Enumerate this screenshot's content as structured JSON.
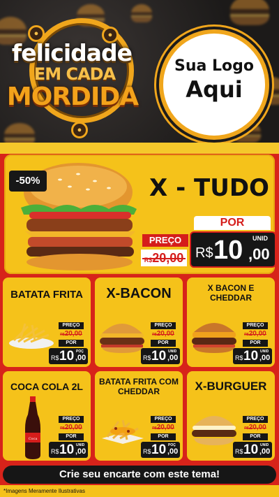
{
  "header": {
    "brand_line1": "felicidade",
    "brand_line2": "EM CADA",
    "brand_line3": "MORDIDA",
    "logo_line1": "Sua Logo",
    "logo_line2": "Aqui"
  },
  "hero": {
    "discount": "-50%",
    "title": "X - TUDO",
    "preco_label": "PREÇO",
    "old_currency": "R$",
    "old_price": "20,00",
    "por_label": "POR",
    "currency": "R$",
    "price_int": "10",
    "price_cents": ",00",
    "unit": "UNID"
  },
  "cards": [
    {
      "name": "BATATA FRITA",
      "preco_label": "PREÇO",
      "old_currency": "R$",
      "old_price": "20,00",
      "por_label": "POR",
      "currency": "R$",
      "price_int": "10",
      "price_cents": ",00",
      "unit": "POÇ"
    },
    {
      "name": "X-BACON",
      "preco_label": "PREÇO",
      "old_currency": "R$",
      "old_price": "20,00",
      "por_label": "POR",
      "currency": "R$",
      "price_int": "10",
      "price_cents": ",00",
      "unit": "UNID"
    },
    {
      "name": "X BACON E CHEDDAR",
      "preco_label": "PREÇO",
      "old_currency": "R$",
      "old_price": "20,00",
      "por_label": "POR",
      "currency": "R$",
      "price_int": "10",
      "price_cents": ",00",
      "unit": "UNID"
    },
    {
      "name": "COCA COLA 2L",
      "preco_label": "PREÇO",
      "old_currency": "R$",
      "old_price": "20,00",
      "por_label": "POR",
      "currency": "R$",
      "price_int": "10",
      "price_cents": ",00",
      "unit": "UNID"
    },
    {
      "name": "BATATA FRITA COM CHEDDAR",
      "preco_label": "PREÇO",
      "old_currency": "R$",
      "old_price": "20,00",
      "por_label": "POR",
      "currency": "R$",
      "price_int": "10",
      "price_cents": ",00",
      "unit": "POÇ"
    },
    {
      "name": "X-BURGUER",
      "preco_label": "PREÇO",
      "old_currency": "R$",
      "old_price": "20,00",
      "por_label": "POR",
      "currency": "R$",
      "price_int": "10",
      "price_cents": ",00",
      "unit": "UNID"
    }
  ],
  "cta": "Crie seu encarte com este tema!",
  "disclaimer": "*Imagens Meramente Ilustrativas",
  "colors": {
    "yellow": "#f5c21a",
    "red": "#d51d1b",
    "dark": "#161616",
    "orange": "#f0a61c"
  }
}
